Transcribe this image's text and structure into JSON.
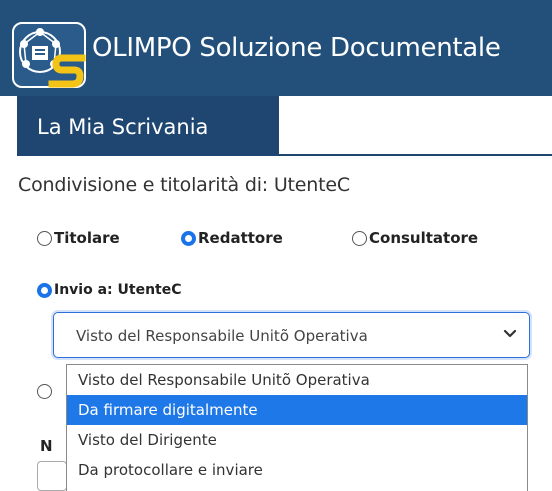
{
  "header": {
    "title": "OLIMPO Soluzione Documentale"
  },
  "nav": {
    "tab_label": "La Mia Scrivania"
  },
  "form": {
    "section_title": "Condivisione e titolarità di: UtenteC",
    "roles": [
      {
        "label": "Titolare",
        "checked": false
      },
      {
        "label": "Redattore",
        "checked": true
      },
      {
        "label": "Consultatore",
        "checked": false
      }
    ],
    "invio": {
      "label": "Invio a: UtenteC",
      "checked": true
    },
    "select": {
      "value": "Visto del Responsabile Unitõ Operativa",
      "options": [
        "Visto del Responsabile Unitõ Operativa",
        "Da firmare digitalmente",
        "Visto del Dirigente",
        "Da protocollare e inviare"
      ],
      "highlighted_index": 1
    },
    "partial_label": "N"
  },
  "colors": {
    "header_bg": "#23507a",
    "nav_tab_bg": "#1e4670",
    "accent": "#1f78e8"
  }
}
